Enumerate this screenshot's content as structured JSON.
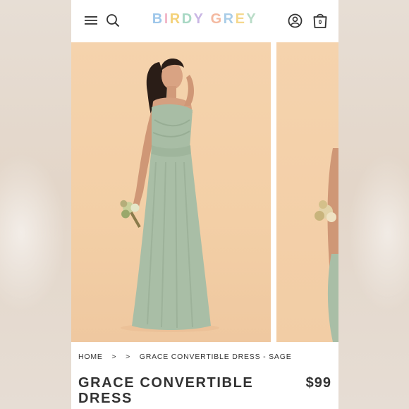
{
  "header": {
    "logo": {
      "letters": [
        "B",
        "I",
        "R",
        "D",
        "Y",
        " ",
        "G",
        "R",
        "E",
        "Y"
      ],
      "colors": [
        "#9ec7ea",
        "#f2b6c8",
        "#f4d27a",
        "#a8d8c4",
        "#c9b6e4",
        "#ffffff",
        "#f4b9a0",
        "#a9cde8",
        "#f5d88d",
        "#b9dcc7"
      ]
    },
    "cart_count": "0",
    "icons": [
      "menu-icon",
      "search-icon",
      "account-icon",
      "cart-icon"
    ]
  },
  "breadcrumb": {
    "home": "HOME",
    "separator_1": ">",
    "separator_2": ">",
    "current": "GRACE CONVERTIBLE DRESS - SAGE"
  },
  "product": {
    "title": "GRACE CONVERTIBLE DRESS",
    "price": "$99"
  },
  "colors": {
    "photo_background": "#f5d3ad",
    "dress_sage": "#a9bda6",
    "text": "#333333"
  }
}
